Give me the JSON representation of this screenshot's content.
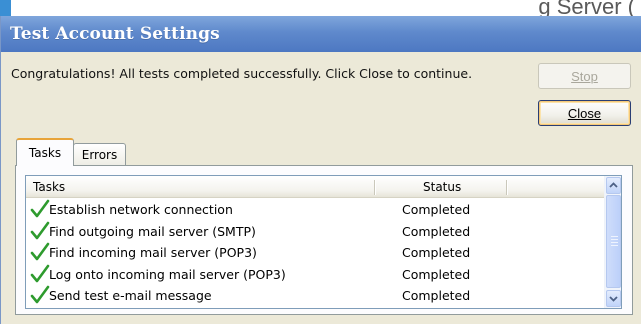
{
  "background": {
    "partial_text": "g Server (",
    "accent_color": "#3a8fd4"
  },
  "dialog": {
    "title": "Test Account Settings",
    "message": "Congratulations! All tests completed successfully. Click Close to continue.",
    "buttons": {
      "stop": {
        "label": "Stop",
        "enabled": false
      },
      "close": {
        "label": "Close",
        "enabled": true,
        "default": true
      }
    },
    "tabs": [
      {
        "label": "Tasks",
        "selected": true
      },
      {
        "label": "Errors",
        "selected": false
      }
    ],
    "table": {
      "columns": [
        "Tasks",
        "Status"
      ],
      "rows": [
        {
          "task": "Establish network connection",
          "status": "Completed",
          "icon": "check-icon"
        },
        {
          "task": "Find outgoing mail server (SMTP)",
          "status": "Completed",
          "icon": "check-icon"
        },
        {
          "task": "Find incoming mail server (POP3)",
          "status": "Completed",
          "icon": "check-icon"
        },
        {
          "task": "Log onto incoming mail server (POP3)",
          "status": "Completed",
          "icon": "check-icon"
        },
        {
          "task": "Send test e-mail message",
          "status": "Completed",
          "icon": "check-icon"
        }
      ]
    }
  },
  "colors": {
    "titlebar": "#5f89cc",
    "check": "#2e9b2e",
    "tab_highlight": "#e8a43a"
  }
}
